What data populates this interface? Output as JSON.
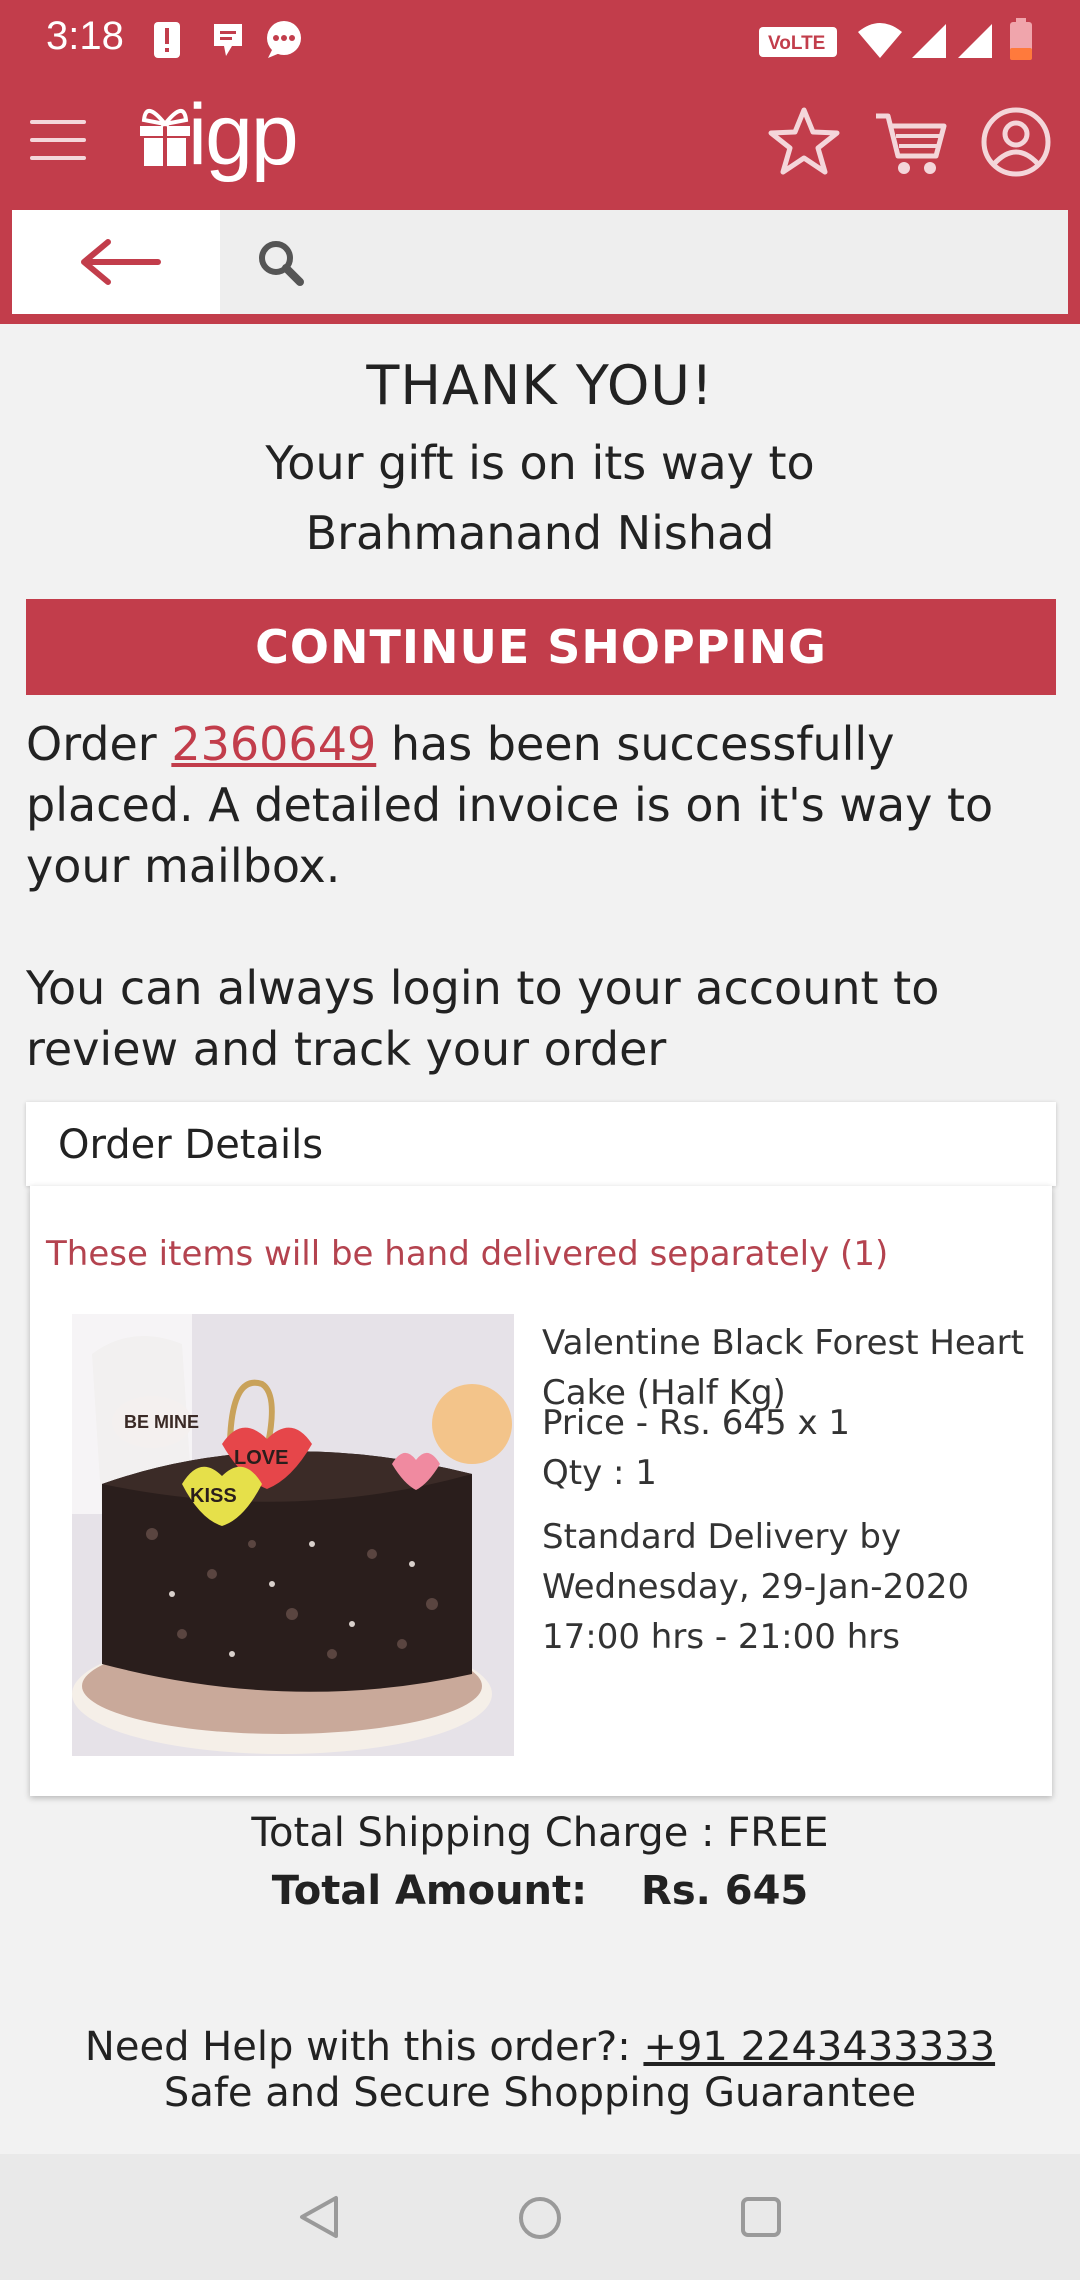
{
  "status_bar": {
    "time": "3:18",
    "left_icons": [
      "alert-icon",
      "message-icon",
      "chat-bubble-icon"
    ],
    "right_icons": [
      "volte-icon",
      "wifi-icon",
      "signal-icon",
      "signal-icon",
      "battery-icon"
    ],
    "volte_label": "VoLTE"
  },
  "app_bar": {
    "logo_text": "igp",
    "icons": [
      "menu-icon",
      "star-icon",
      "cart-icon",
      "account-icon"
    ]
  },
  "search": {
    "placeholder": ""
  },
  "confirmation": {
    "title": "THANK YOU!",
    "subtitle_line1": "Your gift is on its way to",
    "subtitle_line2": "Brahmanand Nishad",
    "continue_label": "CONTINUE SHOPPING",
    "order_prefix": "Order ",
    "order_number": "2360649",
    "order_suffix": " has been successfully placed. A detailed invoice is on it's way to your mailbox.",
    "login_note": "You can always login to your account to review and track your order"
  },
  "order_details": {
    "header": "Order Details",
    "delivery_note": "These items will be hand delivered separately (1)",
    "item": {
      "name": "Valentine Black Forest Heart Cake (Half Kg)",
      "price": "Price - Rs. 645 x 1",
      "qty": "Qty : 1",
      "delivery_line1": "Standard Delivery by",
      "delivery_line2": "Wednesday, 29-Jan-2020",
      "delivery_line3": "17:00 hrs - 21:00 hrs",
      "cake_labels": [
        "BE MINE",
        "LOVE",
        "KISS"
      ]
    }
  },
  "totals": {
    "shipping": "Total Shipping Charge : FREE",
    "amount_label": "Total Amount:",
    "amount_value": "Rs. 645"
  },
  "help": {
    "prefix": "Need Help with this order?: ",
    "phone": "+91 2243433333",
    "guarantee": "Safe and Secure Shopping Guarantee"
  },
  "colors": {
    "brand": "#c23d4b",
    "background": "#f2f2f2"
  },
  "nav_bar": {
    "icons": [
      "back-triangle-icon",
      "home-circle-icon",
      "recents-square-icon"
    ]
  }
}
